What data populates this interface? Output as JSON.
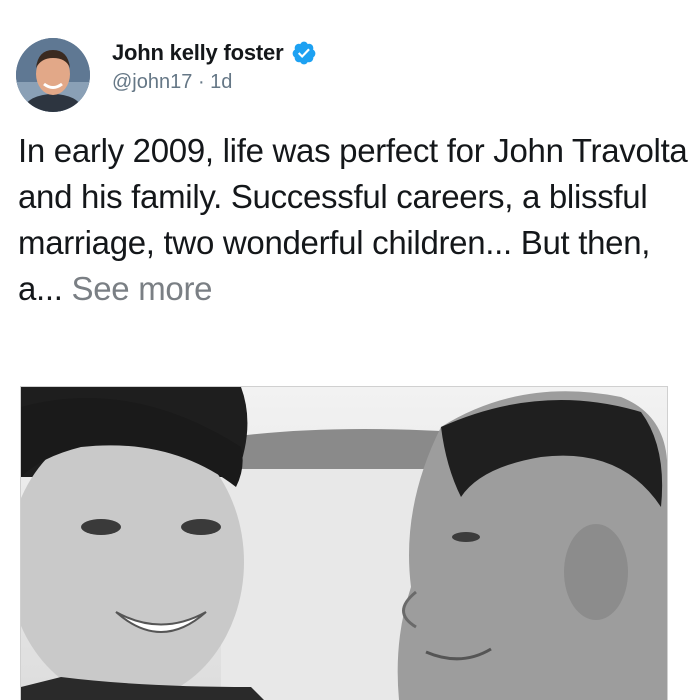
{
  "author": {
    "name": "John kelly foster",
    "handle": "@john17",
    "separator": "·",
    "time": "1d"
  },
  "tweet": {
    "text": "In early 2009, life was perfect for John Travolta and his family. Successful careers, a blissful marriage, two wonderful children... But then, a... ",
    "see_more_label": "See more"
  },
  "icons": {
    "verified": "verified-badge-icon"
  },
  "colors": {
    "verified_blue": "#1da1f2",
    "text": "#14171a",
    "secondary": "#657786",
    "see_more": "#7a7f84"
  }
}
